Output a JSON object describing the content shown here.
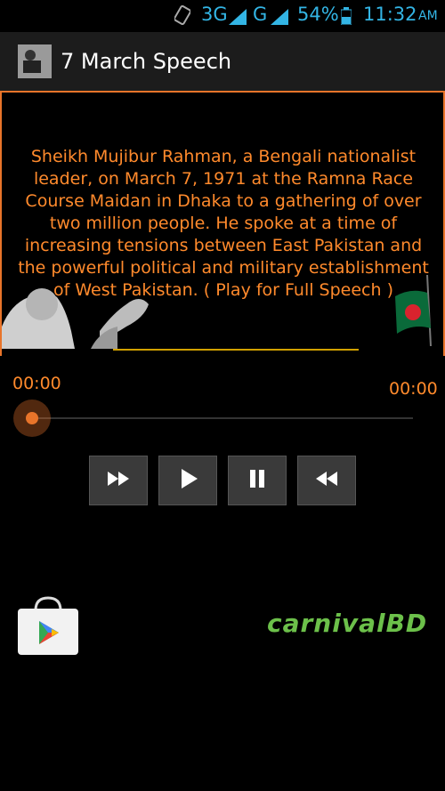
{
  "status_bar": {
    "network_3g": "3G",
    "network_g": "G",
    "battery": "54%",
    "time": "11:32",
    "ampm": "AM"
  },
  "app": {
    "title": "7 March Speech"
  },
  "main": {
    "description": "Sheikh Mujibur Rahman, a Bengali nationalist leader, on March 7, 1971 at the Ramna Race Course Maidan in Dhaka to a gathering of over two million people. He spoke at a time of increasing tensions between East Pakistan and the powerful political and military establishment of West Pakistan. ( Play for Full Speech )"
  },
  "player": {
    "current_time": "00:00",
    "total_time": "00:00",
    "progress": 0
  },
  "icons": {
    "controls": [
      "fast-forward-icon",
      "play-icon",
      "pause-icon",
      "rewind-icon"
    ]
  },
  "footer": {
    "brand": "carnivalBD"
  },
  "colors": {
    "accent": "#e8742a",
    "text_orange": "#ff8a2c",
    "status_blue": "#33b5e5",
    "brand_green": "#6cc04a"
  }
}
